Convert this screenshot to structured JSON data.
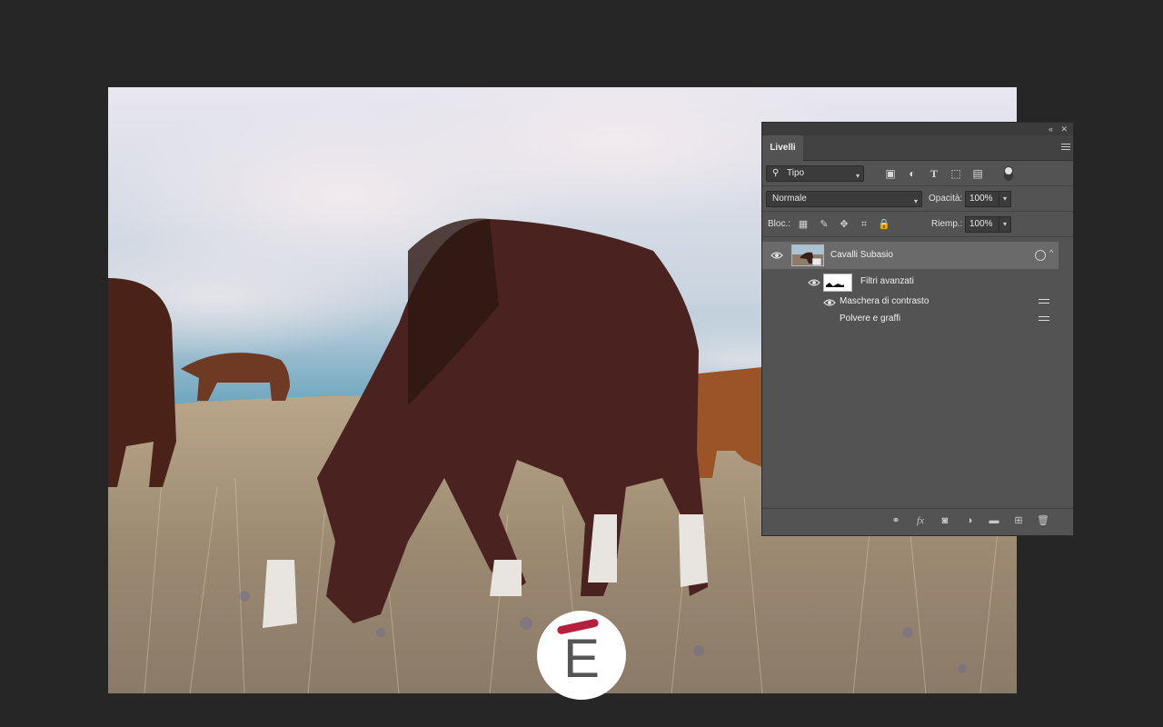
{
  "panel": {
    "tab": "Livelli",
    "filter": {
      "label": "Tipo",
      "icons": [
        "image-icon",
        "adjustment-icon",
        "type-icon",
        "shape-icon",
        "smart-object-icon",
        "filter-toggle-icon"
      ]
    },
    "blend": {
      "mode": "Normale",
      "opacity_label": "Opacità:",
      "opacity_value": "100%"
    },
    "lock": {
      "label": "Bloc.:",
      "icons": [
        "lock-transparent-icon",
        "lock-pixels-icon",
        "lock-position-icon",
        "lock-artboard-icon",
        "lock-all-icon"
      ],
      "fill_label": "Riemp.:",
      "fill_value": "100%"
    },
    "layers": [
      {
        "name": "Cavalli Subasio",
        "type": "smart-object",
        "visible": true,
        "selected": true
      },
      {
        "name": "Filtri avanzati",
        "type": "smart-filters",
        "visible": true
      },
      {
        "name": "Maschera di contrasto",
        "type": "filter",
        "visible": true
      },
      {
        "name": "Polvere e graffi",
        "type": "filter",
        "visible": true
      }
    ],
    "footer_icons": [
      "link-icon",
      "fx-icon",
      "mask-icon",
      "adjustment-layer-icon",
      "group-icon",
      "new-layer-icon",
      "trash-icon"
    ]
  },
  "logo": {
    "letter": "E",
    "accent_color": "#b61f3c"
  },
  "colors": {
    "workspace": "#262626",
    "panel": "#535353",
    "selected_layer": "#6a6a6a"
  }
}
